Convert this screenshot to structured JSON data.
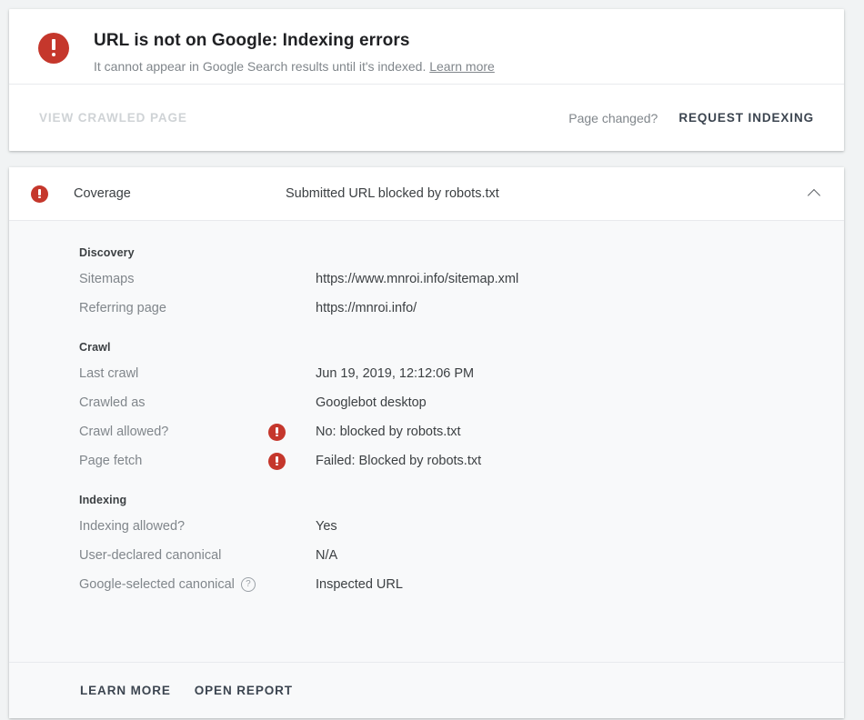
{
  "status_card": {
    "icon": "error-icon",
    "title": "URL is not on Google: Indexing errors",
    "subtitle_text": "It cannot appear in Google Search results until it's indexed.",
    "learn_more_label": "Learn more",
    "view_crawled_page_label": "VIEW CRAWLED PAGE",
    "page_changed_label": "Page changed?",
    "request_indexing_label": "REQUEST INDEXING"
  },
  "coverage_card": {
    "icon": "error-icon",
    "label": "Coverage",
    "value": "Submitted URL blocked by robots.txt",
    "collapse_icon": "chevron-up-icon",
    "sections": [
      {
        "title": "Discovery",
        "rows": [
          {
            "label": "Sitemaps",
            "icon": "",
            "value": "https://www.mnroi.info/sitemap.xml"
          },
          {
            "label": "Referring page",
            "icon": "",
            "value": "https://mnroi.info/"
          }
        ]
      },
      {
        "title": "Crawl",
        "rows": [
          {
            "label": "Last crawl",
            "icon": "",
            "value": "Jun 19, 2019, 12:12:06 PM"
          },
          {
            "label": "Crawled as",
            "icon": "",
            "value": "Googlebot desktop"
          },
          {
            "label": "Crawl allowed?",
            "icon": "error-icon",
            "value": "No: blocked by robots.txt"
          },
          {
            "label": "Page fetch",
            "icon": "error-icon",
            "value": "Failed: Blocked by robots.txt"
          }
        ]
      },
      {
        "title": "Indexing",
        "rows": [
          {
            "label": "Indexing allowed?",
            "icon": "",
            "value": "Yes"
          },
          {
            "label": "User-declared canonical",
            "icon": "",
            "value": "N/A"
          },
          {
            "label": "Google-selected canonical",
            "icon": "",
            "help": "?",
            "value": "Inspected URL"
          }
        ]
      }
    ],
    "footer": {
      "learn_more_label": "LEARN MORE",
      "open_report_label": "OPEN REPORT"
    }
  },
  "colors": {
    "error_red": "#c5372c",
    "page_bg": "#f1f3f4",
    "body_bg": "#f8f9fa",
    "text_primary": "#3c4043",
    "text_secondary": "#80868b",
    "action_text": "#3c4550",
    "disabled_text": "#cfd3d6"
  }
}
